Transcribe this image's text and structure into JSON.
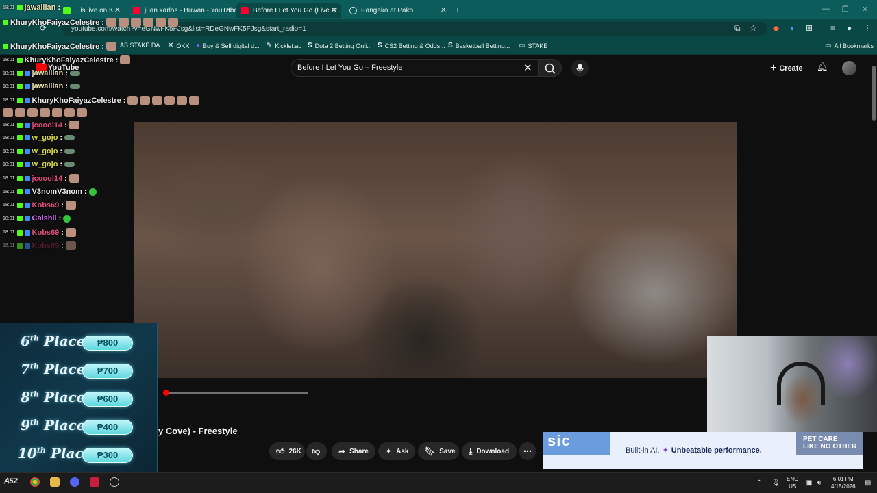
{
  "browser": {
    "tabs": [
      {
        "title": "...is live on K"
      },
      {
        "title": "juan karlos - Buwan - YouTube"
      },
      {
        "title": "Before I Let You Go (Live at The"
      },
      {
        "title": "Pangako at Pako"
      }
    ],
    "url": "youtube.com/watch?v=eGNwFK5FJsg&list=RDeGNwFK5FJsg&start_radio=1",
    "bookmarks": [
      "BU...AS STAKE DA...",
      "OKX",
      "Buy & Sell digital d...",
      "Kicklet.ap",
      "Dota 2 Betting Onli...",
      "CS2 Betting & Odds...",
      "Basketball Betting...",
      "STAKE"
    ],
    "all_bookmarks": "All Bookmarks"
  },
  "youtube": {
    "logo": "YouTube",
    "search_value": "Before I Let You Go – Freestyle",
    "create_label": "Create",
    "video_title": "y Cove) - Freestyle",
    "progress": 0.02,
    "actions": {
      "likes": "26K",
      "share": "Share",
      "ask": "Ask",
      "save": "Save",
      "download": "Download"
    }
  },
  "chat": [
    {
      "time": "18:01",
      "user": "jawailian",
      "color": "#e6e0b0",
      "emotes": 0
    },
    {
      "time": "",
      "user": "KhuryKhoFaiyazCelestre",
      "color": "#e8e8e8",
      "emotes": 6
    },
    {
      "time": "",
      "user": "KhuryKhoFaiyazCelestre",
      "color": "#e8e8e8",
      "emotes": 1
    },
    {
      "time": "18:01",
      "user": "KhuryKhoFaiyazCelestre",
      "color": "#e8e8e8",
      "emotes": 1
    },
    {
      "time": "18:01",
      "user": "jawailian",
      "color": "#e6e0b0",
      "emotes": 1
    },
    {
      "time": "18:01",
      "user": "jawailian",
      "color": "#e6e0b0",
      "emotes": 1
    },
    {
      "time": "18:01",
      "user": "KhuryKhoFaiyazCelestre",
      "color": "#e8e8e8",
      "emotes": 13
    },
    {
      "time": "18:01",
      "user": "jcoool14",
      "color": "#e0507a",
      "emotes": 1
    },
    {
      "time": "18:01",
      "user": "w_gojo",
      "color": "#d8d84a",
      "emotes": 1
    },
    {
      "time": "18:01",
      "user": "w_gojo",
      "color": "#d8d84a",
      "emotes": 1
    },
    {
      "time": "18:01",
      "user": "w_gojo",
      "color": "#d8d84a",
      "emotes": 1
    },
    {
      "time": "18:01",
      "user": "jcoool14",
      "color": "#e0507a",
      "emotes": 1
    },
    {
      "time": "18:01",
      "user": "V3nomV3nom",
      "color": "#e8e8e8",
      "emotes": 1
    },
    {
      "time": "18:01",
      "user": "Kobs69",
      "color": "#e0507a",
      "emotes": 1
    },
    {
      "time": "18:01",
      "user": "Caishii",
      "color": "#d96bff",
      "emotes": 1
    },
    {
      "time": "18:01",
      "user": "Kobs69",
      "color": "#e0507a",
      "emotes": 1
    },
    {
      "time": "18:01",
      "user": "Kobs69",
      "color": "#7a2a3e",
      "emotes": 1
    }
  ],
  "prizes": [
    {
      "ord": "6",
      "suffix": "th",
      "label": "Place",
      "amount": "₱800"
    },
    {
      "ord": "7",
      "suffix": "th",
      "label": "Place",
      "amount": "₱700"
    },
    {
      "ord": "8",
      "suffix": "th",
      "label": "Place",
      "amount": "₱600"
    },
    {
      "ord": "9",
      "suffix": "th",
      "label": "Place",
      "amount": "₱400"
    },
    {
      "ord": "10",
      "suffix": "th",
      "label": "Place",
      "amount": "₱300"
    }
  ],
  "ad": {
    "logo": "sic",
    "tagline_a": "Built-in AI.",
    "tagline_b": "Unbeatable performance.",
    "side_line1": "PET CARE",
    "side_line2": "LIKE NO OTHER"
  },
  "taskbar": {
    "lang1": "ENG",
    "lang2": "US",
    "time": "6:01 PM",
    "date": "4/15/2026"
  },
  "colors": {
    "chrome_accent": "#0b5c5a",
    "yt_red": "#ff0000",
    "prize_pill": "#5fd7e0"
  }
}
